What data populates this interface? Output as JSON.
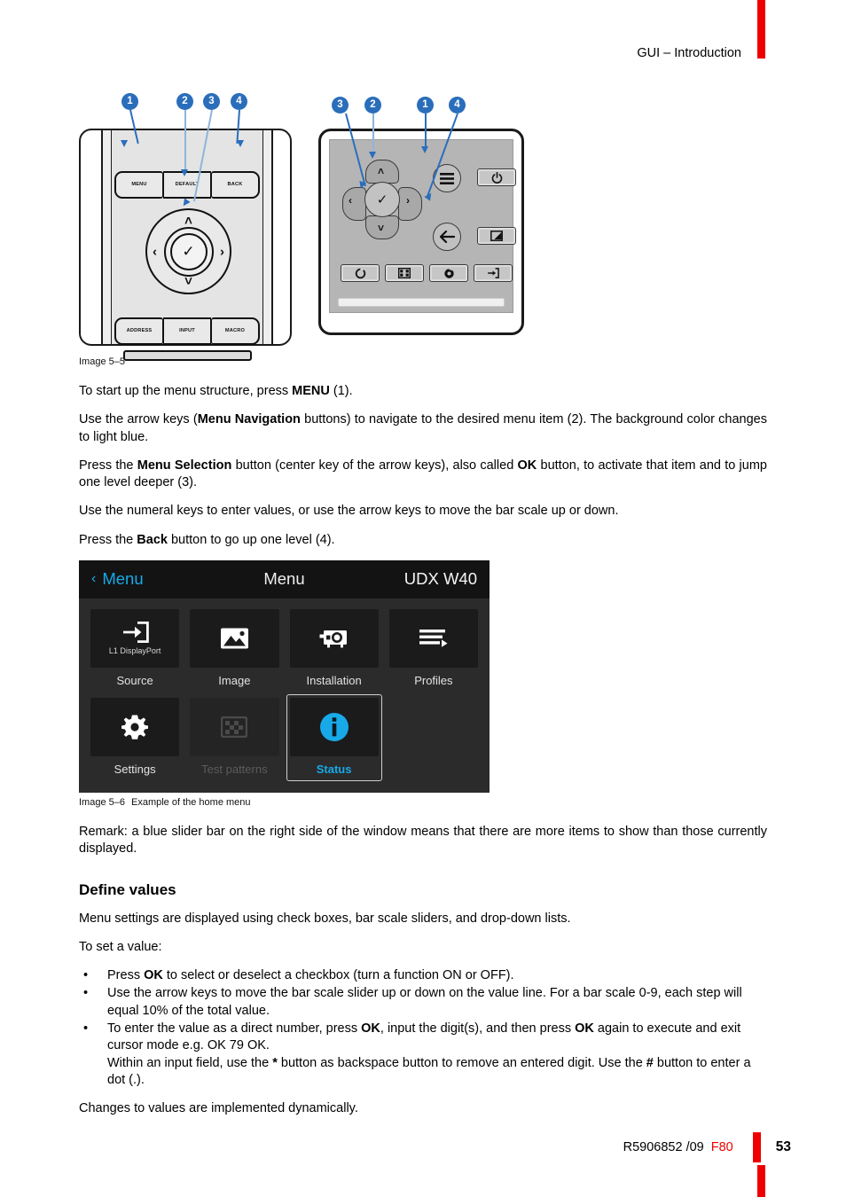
{
  "header": {
    "title": "GUI – Introduction"
  },
  "figure1": {
    "caption": "Image 5–5",
    "caption_title": "",
    "callouts": [
      "1",
      "2",
      "3",
      "4"
    ],
    "remote": {
      "top_buttons": [
        "MENU",
        "DEFAULT",
        "BACK"
      ],
      "bottom_buttons": [
        "ADDRESS",
        "INPUT",
        "MACRO"
      ],
      "dpad": {
        "up": "˄",
        "down": "˅",
        "left": "‹",
        "right": "›",
        "center": "✓"
      }
    },
    "keypad": {
      "callouts": [
        "3",
        "2",
        "1",
        "4"
      ],
      "dpad": {
        "up": "˄",
        "down": "˅",
        "left": "‹",
        "right": "›",
        "center": "✓"
      },
      "menu_button": "menu-icon",
      "back_button": "back-arrow-icon",
      "power_button": "power-icon",
      "contrast_button": "contrast-icon",
      "bottom_buttons": [
        "shutter-icon",
        "test-pattern-icon",
        "lens-focus-icon",
        "input-select-icon"
      ]
    }
  },
  "body": {
    "p1_pre": "To start up the menu structure, press ",
    "p1_bold": "MENU",
    "p1_post": " (1).",
    "p2_pre": "Use the arrow keys (",
    "p2_bold": "Menu Navigation",
    "p2_post": " buttons) to navigate to the desired menu item (2). The background color changes to light blue.",
    "p3_pre": "Press the ",
    "p3_bold1": "Menu Selection",
    "p3_mid": " button (center key of the arrow keys), also called ",
    "p3_bold2": "OK",
    "p3_post": " button, to activate that item and to jump one level deeper (3).",
    "p4": "Use the numeral keys to enter values, or use the arrow keys to move the bar scale up or down.",
    "p5_pre": "Press the ",
    "p5_bold": "Back",
    "p5_post": " button to go up one level (4).",
    "remark": "Remark: a blue slider bar on the right side of the window means that there are more items to show than those currently displayed."
  },
  "osd": {
    "back_label": "Menu",
    "back_chevron": "‹",
    "title": "Menu",
    "model": "UDX W40",
    "tiles": [
      {
        "label": "Source",
        "sub": "L1 DisplayPort",
        "icon": "source-input-icon",
        "state": "normal"
      },
      {
        "label": "Image",
        "sub": "",
        "icon": "image-picture-icon",
        "state": "normal"
      },
      {
        "label": "Installation",
        "sub": "",
        "icon": "projector-icon",
        "state": "normal"
      },
      {
        "label": "Profiles",
        "sub": "",
        "icon": "profiles-list-icon",
        "state": "normal"
      },
      {
        "label": "Settings",
        "sub": "",
        "icon": "gear-icon",
        "state": "normal"
      },
      {
        "label": "Test patterns",
        "sub": "",
        "icon": "test-pattern-icon",
        "state": "disabled"
      },
      {
        "label": "Status",
        "sub": "",
        "icon": "info-icon",
        "state": "selected"
      }
    ]
  },
  "figure2": {
    "caption": "Image 5–6",
    "caption_title": "Example of the home menu"
  },
  "define_values": {
    "heading": "Define values",
    "intro": "Menu settings are displayed using check boxes, bar scale sliders, and drop-down lists.",
    "lead": "To set a value:",
    "b1_pre": "Press ",
    "b1_bold": "OK",
    "b1_post": " to select or deselect a checkbox (turn a function ON or OFF).",
    "b2": "Use the arrow keys to move the bar scale slider up or down on the value line. For a bar scale 0-9, each step will equal 10% of the total value.",
    "b3_pre": "To enter the value as a direct number, press ",
    "b3_bold1": "OK",
    "b3_mid1": ", input the digit(s), and then press ",
    "b3_bold2": "OK",
    "b3_mid2": " again to execute and exit cursor mode e.g. OK 79 OK.",
    "b3_line2_pre": "Within an input field, use the ",
    "b3_line2_bold1": "*",
    "b3_line2_mid": " button as backspace button to remove an entered digit. Use the ",
    "b3_line2_bold2": "#",
    "b3_line2_post": " button to enter a dot (.).",
    "closing": "Changes to values are implemented dynamically."
  },
  "footer": {
    "doc_number": "R5906852 /09",
    "revision": "F80",
    "page_number": "53"
  },
  "colors": {
    "accent_red": "#ee0000",
    "callout_blue": "#2a6ebb",
    "osd_blue": "#17a9e8",
    "osd_bg": "#2b2b2b",
    "osd_header_bg": "#131313"
  }
}
